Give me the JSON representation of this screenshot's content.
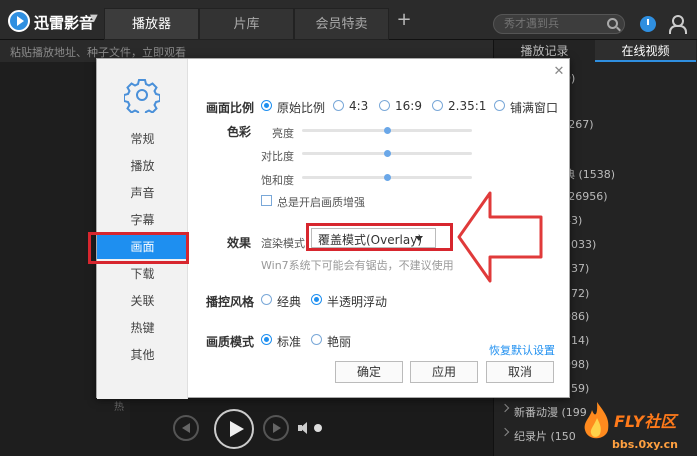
{
  "app": {
    "title": "迅雷影音"
  },
  "tabs": [
    {
      "label": "播放器"
    },
    {
      "label": "片库"
    },
    {
      "label": "会员特卖"
    }
  ],
  "search": {
    "placeholder": "秀才遇到兵"
  },
  "subbar": {
    "hint": "粘贴播放地址、种子文件，立即观看"
  },
  "right_panel": {
    "tabs": [
      {
        "label": "播放记录"
      },
      {
        "label": "在线视频"
      }
    ],
    "items": [
      {
        "text": "9)"
      },
      {
        "text": "(267)"
      },
      {
        "text": ""
      },
      {
        "text": "典 (1538)"
      },
      {
        "text": "(26956)"
      },
      {
        "text": "43)"
      },
      {
        "text": "1033)"
      },
      {
        "text": "337)"
      },
      {
        "text": "272)"
      },
      {
        "text": "086)"
      },
      {
        "text": "214)"
      },
      {
        "text": "998)"
      },
      {
        "text": "259)"
      },
      {
        "text": "新番动漫 (199"
      },
      {
        "text": "纪录片 (150"
      }
    ]
  },
  "dialog": {
    "sidebar": [
      {
        "label": "常规"
      },
      {
        "label": "播放"
      },
      {
        "label": "声音"
      },
      {
        "label": "字幕"
      },
      {
        "label": "画面"
      },
      {
        "label": "下载"
      },
      {
        "label": "关联"
      },
      {
        "label": "热键"
      },
      {
        "label": "其他"
      }
    ],
    "aspect": {
      "label": "画面比例",
      "options": [
        {
          "label": "原始比例",
          "selected": true
        },
        {
          "label": "4:3"
        },
        {
          "label": "16:9"
        },
        {
          "label": "2.35:1"
        },
        {
          "label": "铺满窗口"
        }
      ]
    },
    "color": {
      "label": "色彩",
      "sliders": [
        {
          "label": "亮度",
          "value": 0.5
        },
        {
          "label": "对比度",
          "value": 0.5
        },
        {
          "label": "饱和度",
          "value": 0.5
        }
      ],
      "enhance_label": "总是开启画质增强"
    },
    "effect": {
      "label": "效果",
      "render_label": "渲染模式",
      "render_value": "覆盖模式(Overlay)",
      "warning": "Win7系统下可能会有锯齿，不建议使用"
    },
    "control_style": {
      "label": "播控风格",
      "options": [
        {
          "label": "经典"
        },
        {
          "label": "半透明浮动",
          "selected": true
        }
      ]
    },
    "quality_mode": {
      "label": "画质模式",
      "options": [
        {
          "label": "标准",
          "selected": true
        },
        {
          "label": "艳丽"
        }
      ]
    },
    "restore_default": "恢复默认设置",
    "buttons": {
      "ok": "确定",
      "apply": "应用",
      "cancel": "取消"
    }
  },
  "hot_label": "热",
  "watermark": {
    "brand": "FLY社区",
    "url": "bbs.0xy.cn"
  },
  "colors": {
    "accent": "#1e8ff0",
    "highlight_red": "#d7262e"
  }
}
